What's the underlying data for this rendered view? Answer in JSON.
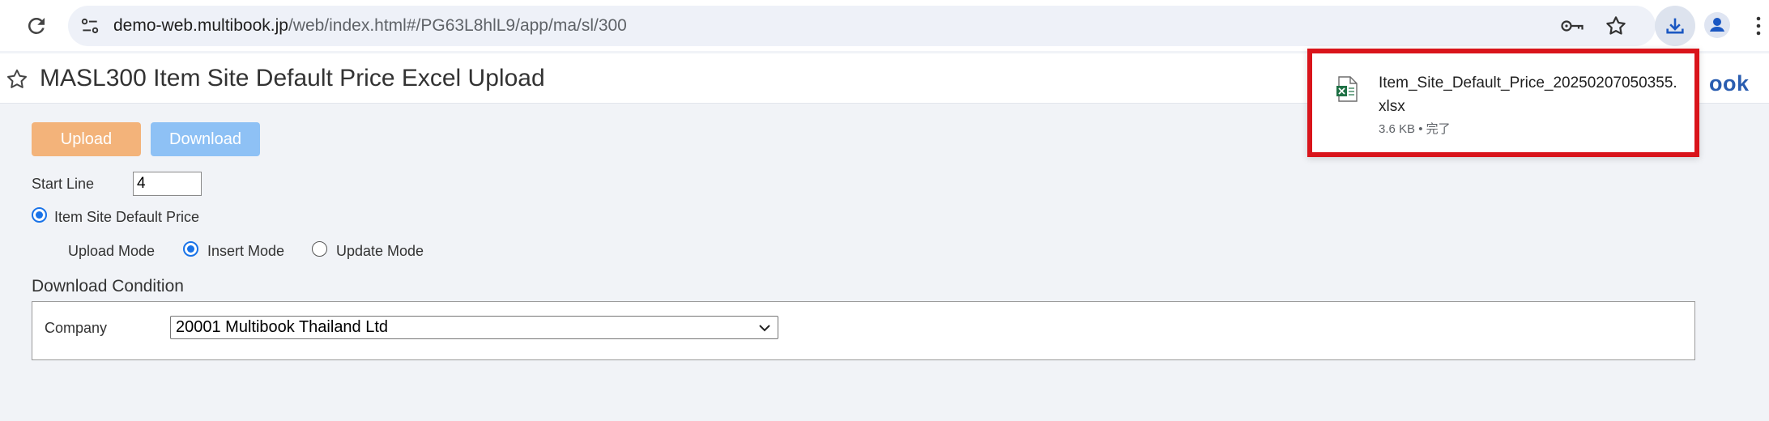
{
  "browser": {
    "url_host": "demo-web.multibook.jp",
    "url_path": "/web/index.html#/PG63L8hlL9/app/ma/sl/300"
  },
  "header": {
    "title": "MASL300 Item Site Default Price Excel Upload",
    "brand_visible": "ook"
  },
  "actions": {
    "upload_label": "Upload",
    "download_label": "Download"
  },
  "form": {
    "start_line_label": "Start Line",
    "start_line_value": "4",
    "item_site_default_price_label": "Item Site Default Price",
    "upload_mode_label": "Upload Mode",
    "insert_mode_label": "Insert Mode",
    "update_mode_label": "Update Mode",
    "selected_mode": "Insert Mode"
  },
  "download_condition": {
    "title": "Download Condition",
    "company_label": "Company",
    "company_value": "20001 Multibook Thailand Ltd"
  },
  "download_popup": {
    "filename": "Item_Site_Default_Price_20250207050355.xlsx",
    "meta": "3.6 KB • 完了"
  },
  "colors": {
    "upload_button": "#f3b37a",
    "download_button": "#8ec1f5",
    "highlight_border": "#d9141b",
    "radio_accent": "#1a73e8"
  }
}
